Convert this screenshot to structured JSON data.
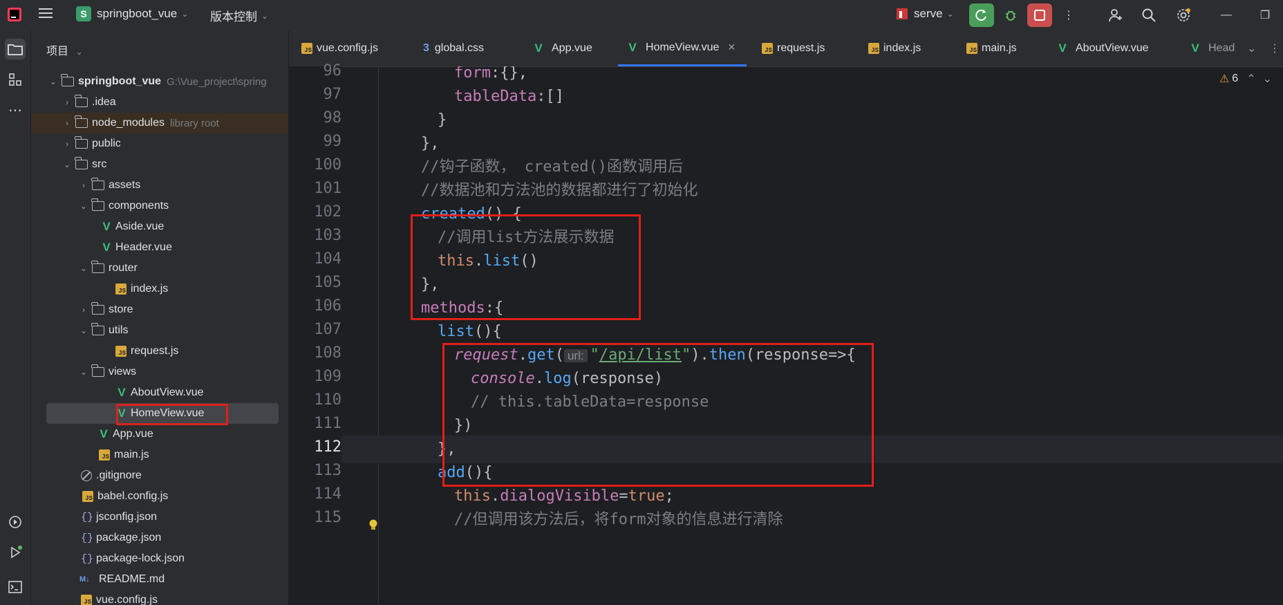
{
  "topbar": {
    "project_badge": "S",
    "project_name": "springboot_vue",
    "vcs_label": "版本控制",
    "run_config": "serve"
  },
  "sidebar": {
    "header": "项目",
    "root_name": "springboot_vue",
    "root_path": "G:\\Vue_project\\spring",
    "items": [
      {
        "label": ".idea"
      },
      {
        "label": "node_modules",
        "note": "library root"
      },
      {
        "label": "public"
      },
      {
        "label": "src"
      },
      {
        "label": "assets"
      },
      {
        "label": "components"
      },
      {
        "label": "Aside.vue"
      },
      {
        "label": "Header.vue"
      },
      {
        "label": "router"
      },
      {
        "label": "index.js"
      },
      {
        "label": "store"
      },
      {
        "label": "utils"
      },
      {
        "label": "request.js"
      },
      {
        "label": "views"
      },
      {
        "label": "AboutView.vue"
      },
      {
        "label": "HomeView.vue"
      },
      {
        "label": "App.vue"
      },
      {
        "label": "main.js"
      },
      {
        "label": ".gitignore"
      },
      {
        "label": "babel.config.js"
      },
      {
        "label": "jsconfig.json"
      },
      {
        "label": "package.json"
      },
      {
        "label": "package-lock.json"
      },
      {
        "label": "README.md"
      },
      {
        "label": "vue.config.js"
      }
    ]
  },
  "tabs": [
    {
      "label": "vue.config.js"
    },
    {
      "label": "global.css"
    },
    {
      "label": "App.vue"
    },
    {
      "label": "HomeView.vue"
    },
    {
      "label": "request.js"
    },
    {
      "label": "index.js"
    },
    {
      "label": "main.js"
    },
    {
      "label": "AboutView.vue"
    },
    {
      "label": "Head"
    }
  ],
  "editor": {
    "warnings_count": "6",
    "line_numbers": [
      "96",
      "97",
      "98",
      "99",
      "100",
      "101",
      "102",
      "103",
      "104",
      "105",
      "106",
      "107",
      "108",
      "109",
      "110",
      "111",
      "112",
      "113",
      "114",
      "115"
    ],
    "code": {
      "l96a": "form",
      "l96b": ":{},",
      "l97a": "tableData",
      "l97b": ":[]",
      "l98": "}",
      "l99": "},",
      "l100a": "//钩子函数， ",
      "l100b": "created()",
      "l100c": "函数调用后",
      "l101": "//数据池和方法池的数据都进行了初始化",
      "l102a": "created",
      "l102b": "() {",
      "l103a": "//调用",
      "l103b": "list",
      "l103c": "方法展示数据",
      "l104a": "this",
      "l104b": ".",
      "l104c": "list",
      "l104d": "()",
      "l105": "},",
      "l106a": "methods",
      "l106b": ":{",
      "l107a": "list",
      "l107b": "(){",
      "l108a": "request",
      "l108b": ".",
      "l108c": "get",
      "l108d": "(",
      "l108hint": "url:",
      "l108e": "\"",
      "l108f": "/api/list",
      "l108g": "\"",
      "l108h": ").",
      "l108i": "then",
      "l108j": "(response=>{",
      "l109a": "console",
      "l109b": ".",
      "l109c": "log",
      "l109d": "(response)",
      "l110": "// this.tableData=response",
      "l111": "})",
      "l112": "},",
      "l113a": "add",
      "l113b": "(){",
      "l114a": "this",
      "l114b": ".",
      "l114c": "dialogVisible",
      "l114d": "=",
      "l114e": "true",
      "l114f": ";",
      "l115a": "//但调用该方法后，将",
      "l115b": "form",
      "l115c": "对象的信息进行清除"
    }
  },
  "colors": {
    "highlight_box": "#e0201a",
    "accent": "#3574f0",
    "vue_green": "#3dbd7d"
  }
}
